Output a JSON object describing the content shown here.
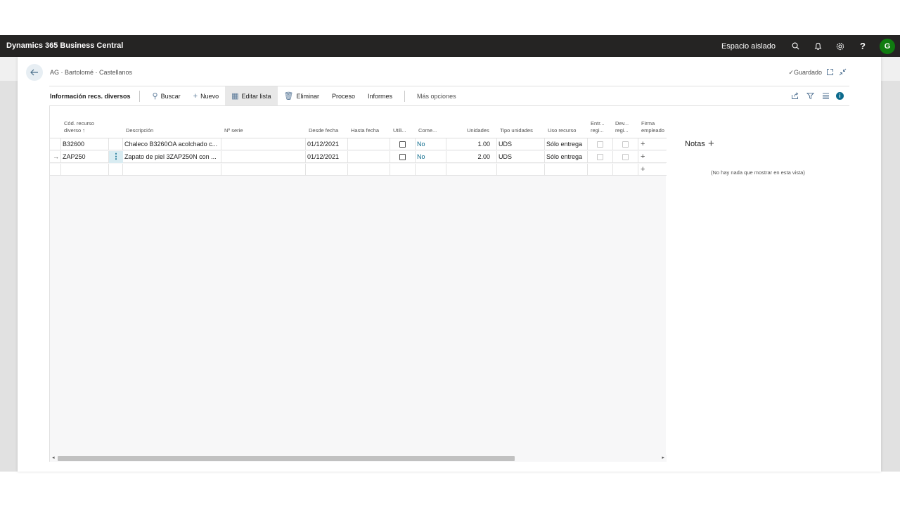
{
  "app": {
    "title": "Dynamics 365 Business Central",
    "environment": "Espacio aislado",
    "avatar_initial": "G"
  },
  "header": {
    "breadcrumb": "AG · Bartolomé · Castellanos",
    "saved_label": "Guardado"
  },
  "actionbar": {
    "caption": "Información recs. diversos",
    "search": "Buscar",
    "new": "Nuevo",
    "edit_list": "Editar lista",
    "delete": "Eliminar",
    "process": "Proceso",
    "reports": "Informes",
    "more": "Más opciones"
  },
  "grid": {
    "columns": {
      "code_line1": "Cód. recurso",
      "code_line2": "diverso",
      "sort_arrow": "↑",
      "description": "Descripción",
      "serial": "Nº serie",
      "from_date": "Desde fecha",
      "to_date": "Hasta fecha",
      "used": "Utili...",
      "comments": "Come...",
      "units": "Unidades",
      "unit_type": "Tipo unidades",
      "resource_use": "Uso recurso",
      "delivered_line1": "Entr...",
      "delivered_line2": "regi...",
      "returned_line1": "Dev...",
      "returned_line2": "regi...",
      "signature_line1": "Firma",
      "signature_line2": "empleado"
    },
    "rows": [
      {
        "code": "B32600",
        "description": "Chaleco B3260OA acolchado c...",
        "serial": "",
        "from_date": "01/12/2021",
        "to_date": "",
        "used": false,
        "comments": "No",
        "units": "1.00",
        "unit_type": "UDS",
        "resource_use": "Sólo entrega",
        "delivered": false,
        "returned": false
      },
      {
        "code": "ZAP250",
        "description": "Zapato de piel 3ZAP250N con ...",
        "serial": "",
        "from_date": "01/12/2021",
        "to_date": "",
        "used": false,
        "comments": "No",
        "units": "2.00",
        "unit_type": "UDS",
        "resource_use": "Sólo entrega",
        "delivered": false,
        "returned": false
      }
    ]
  },
  "notes": {
    "title": "Notas",
    "empty": "(No hay nada que mostrar en esta vista)"
  }
}
